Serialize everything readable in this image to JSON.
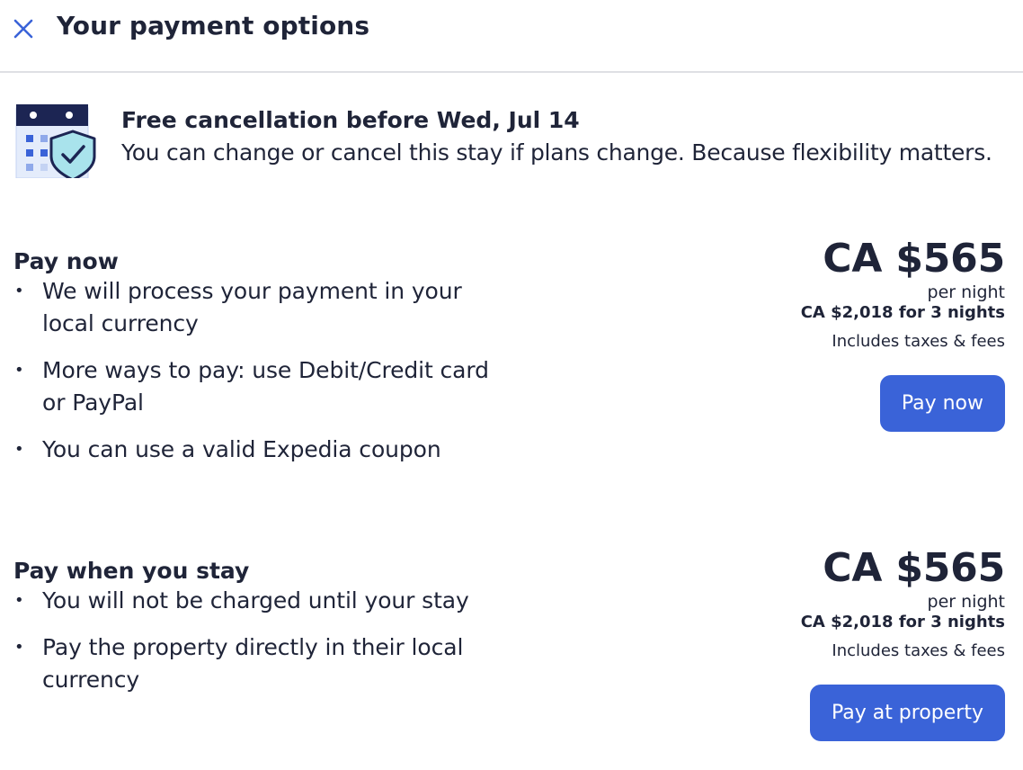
{
  "header": {
    "title": "Your payment options",
    "close_icon": "close-icon"
  },
  "banner": {
    "icon": "calendar-shield-icon",
    "title": "Free cancellation before Wed, Jul 14",
    "description": "You can change or cancel this stay if plans change. Because flexibility matters."
  },
  "options": [
    {
      "title": "Pay now",
      "bullets": [
        "We will process your payment in your local currency",
        "More ways to pay: use Debit/Credit card or PayPal",
        "You can use a valid Expedia coupon"
      ],
      "price": "CA $565",
      "price_unit": "per night",
      "total": "CA $2,018 for 3 nights",
      "note": "Includes taxes & fees",
      "button_label": "Pay now"
    },
    {
      "title": "Pay when you stay",
      "bullets": [
        "You will not be charged until your stay",
        "Pay the property directly in their local currency"
      ],
      "price": "CA $565",
      "price_unit": "per night",
      "total": "CA $2,018 for 3 nights",
      "note": "Includes taxes & fees",
      "button_label": "Pay at property"
    }
  ],
  "colors": {
    "primary_button": "#3a63d8",
    "text": "#1f2438",
    "icon_accent": "#3a63d8",
    "shield_fill": "#a9e3ec",
    "divider": "#dfe0e4"
  }
}
